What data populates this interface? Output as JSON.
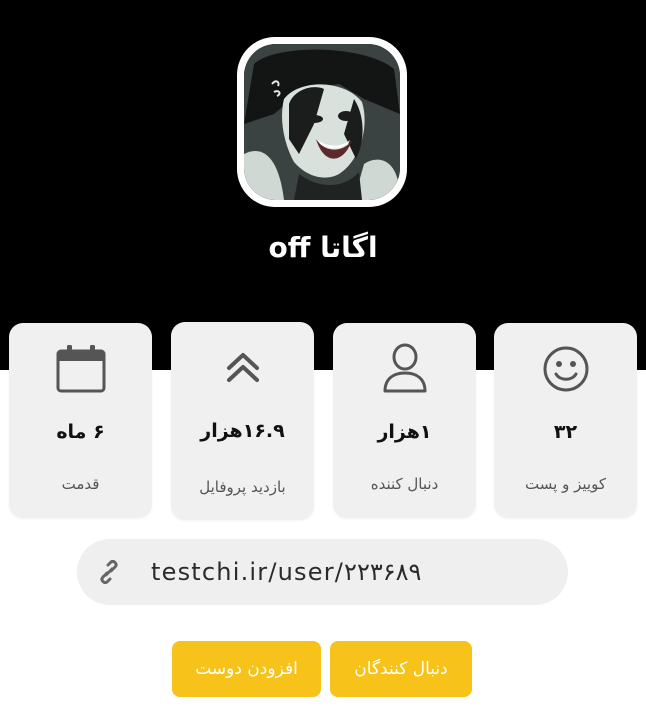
{
  "profile": {
    "name": "اگاتا off"
  },
  "stats": [
    {
      "icon": "calendar-icon",
      "value": "۶ ماه",
      "label": "قدمت"
    },
    {
      "icon": "chevrons-up-icon",
      "value": "۱۶.۹هزار",
      "label": "بازدید پروفایل"
    },
    {
      "icon": "user-icon",
      "value": "۱هزار",
      "label": "دنبال کننده"
    },
    {
      "icon": "smiley-icon",
      "value": "۳۲",
      "label": "کوییز و پست"
    }
  ],
  "link": {
    "icon": "link-icon",
    "text": "testchi.ir/user/۲۲۳۶۸۹"
  },
  "buttons": {
    "add_friend": "افزودن دوست",
    "followers": "دنبال کنندگان"
  },
  "colors": {
    "header_bg": "#000000",
    "card_bg": "#f0f0f0",
    "button_bg": "#f7c21a",
    "icon_gray": "#555555"
  }
}
